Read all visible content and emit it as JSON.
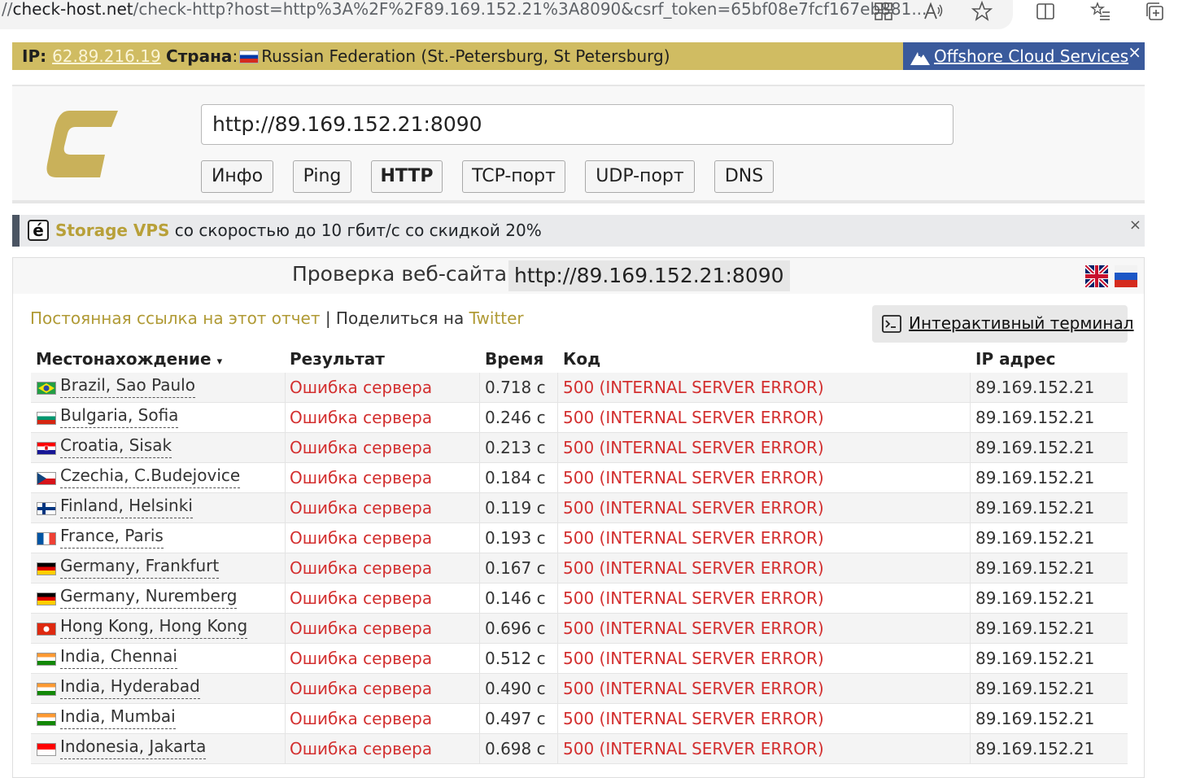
{
  "browser": {
    "url_prefix": "//",
    "url_host": "check-host.net",
    "url_rest": "/check-http?host=http%3A%2F%2F89.169.152.21%3A8090&csrf_token=65bf08e7fcf167eb881..."
  },
  "ipbar": {
    "ip_label": "IP",
    "ip_value": "62.89.216.19",
    "country_label": "Страна",
    "country_value": "Russian Federation (St.-Petersburg, St Petersburg)",
    "ad_link": "Offshore Cloud Services",
    "close": "×"
  },
  "header": {
    "url_value": "http://89.169.152.21:8090",
    "tabs": [
      {
        "label": "Инфо"
      },
      {
        "label": "Ping"
      },
      {
        "label": "HTTP"
      },
      {
        "label": "TCP-порт"
      },
      {
        "label": "UDP-порт"
      },
      {
        "label": "DNS"
      }
    ]
  },
  "promo": {
    "icon_letter": "é",
    "brand": "Storage VPS",
    "text": " со скоростью до 10 гбит/с со скидкой 20%",
    "close": "×"
  },
  "results": {
    "title": "Проверка веб-сайта",
    "host": "http://89.169.152.21:8090",
    "permalink": "Постоянная ссылка на этот отчет",
    "share_sep": " | Поделиться на ",
    "twitter": "Twitter",
    "terminal_label": "Интерактивный терминал",
    "columns": {
      "location": "Местонахождение",
      "sort_arrow": "▾",
      "result": "Результат",
      "time": "Время",
      "code": "Код",
      "ip": "IP адрес"
    },
    "rows": [
      {
        "flag": "br",
        "location": "Brazil, Sao Paulo",
        "result": "Ошибка сервера",
        "time": "0.718 с",
        "code": "500 (INTERNAL SERVER ERROR)",
        "ip": "89.169.152.21"
      },
      {
        "flag": "bg",
        "location": "Bulgaria, Sofia",
        "result": "Ошибка сервера",
        "time": "0.246 с",
        "code": "500 (INTERNAL SERVER ERROR)",
        "ip": "89.169.152.21"
      },
      {
        "flag": "hr",
        "location": "Croatia, Sisak",
        "result": "Ошибка сервера",
        "time": "0.213 с",
        "code": "500 (INTERNAL SERVER ERROR)",
        "ip": "89.169.152.21"
      },
      {
        "flag": "cz",
        "location": "Czechia, C.Budejovice",
        "result": "Ошибка сервера",
        "time": "0.184 с",
        "code": "500 (INTERNAL SERVER ERROR)",
        "ip": "89.169.152.21"
      },
      {
        "flag": "fi",
        "location": "Finland, Helsinki",
        "result": "Ошибка сервера",
        "time": "0.119 с",
        "code": "500 (INTERNAL SERVER ERROR)",
        "ip": "89.169.152.21"
      },
      {
        "flag": "fr",
        "location": "France, Paris",
        "result": "Ошибка сервера",
        "time": "0.193 с",
        "code": "500 (INTERNAL SERVER ERROR)",
        "ip": "89.169.152.21"
      },
      {
        "flag": "de",
        "location": "Germany, Frankfurt",
        "result": "Ошибка сервера",
        "time": "0.167 с",
        "code": "500 (INTERNAL SERVER ERROR)",
        "ip": "89.169.152.21"
      },
      {
        "flag": "de",
        "location": "Germany, Nuremberg",
        "result": "Ошибка сервера",
        "time": "0.146 с",
        "code": "500 (INTERNAL SERVER ERROR)",
        "ip": "89.169.152.21"
      },
      {
        "flag": "hk",
        "location": "Hong Kong, Hong Kong",
        "result": "Ошибка сервера",
        "time": "0.696 с",
        "code": "500 (INTERNAL SERVER ERROR)",
        "ip": "89.169.152.21"
      },
      {
        "flag": "in",
        "location": "India, Chennai",
        "result": "Ошибка сервера",
        "time": "0.512 с",
        "code": "500 (INTERNAL SERVER ERROR)",
        "ip": "89.169.152.21"
      },
      {
        "flag": "in",
        "location": "India, Hyderabad",
        "result": "Ошибка сервера",
        "time": "0.490 с",
        "code": "500 (INTERNAL SERVER ERROR)",
        "ip": "89.169.152.21"
      },
      {
        "flag": "in",
        "location": "India, Mumbai",
        "result": "Ошибка сервера",
        "time": "0.497 с",
        "code": "500 (INTERNAL SERVER ERROR)",
        "ip": "89.169.152.21"
      },
      {
        "flag": "id",
        "location": "Indonesia, Jakarta",
        "result": "Ошибка сервера",
        "time": "0.698 с",
        "code": "500 (INTERNAL SERVER ERROR)",
        "ip": "89.169.152.21"
      }
    ]
  },
  "colors": {
    "gold_bar": "#d0bc62",
    "offshore_blue": "#3a5a9c",
    "error_red": "#d32f2f",
    "brand_gold": "#c9b15a"
  }
}
